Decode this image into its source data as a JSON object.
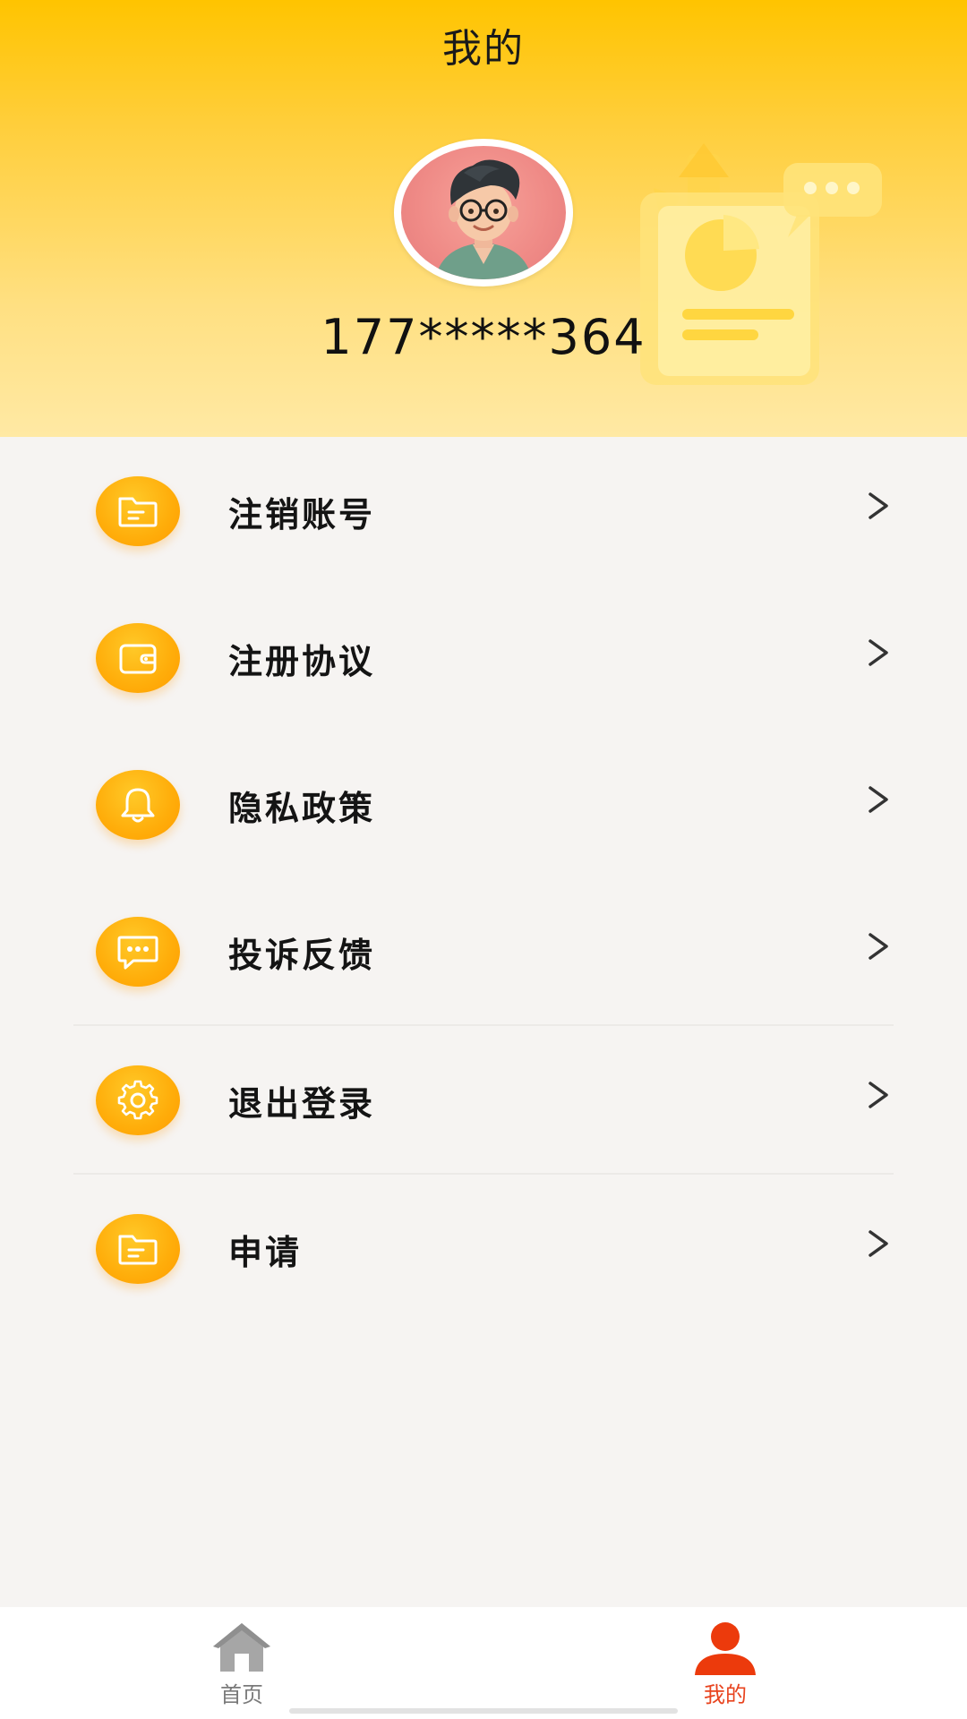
{
  "header": {
    "title": "我的",
    "phone": "177*****364",
    "gradient_top": "#ffc400",
    "gradient_bottom": "#ffe9a4"
  },
  "menu": {
    "items": [
      {
        "label": "注销账号",
        "icon": "folder-card-icon"
      },
      {
        "label": "注册协议",
        "icon": "wallet-icon"
      },
      {
        "label": "隐私政策",
        "icon": "bell-icon"
      },
      {
        "label": "投诉反馈",
        "icon": "chat-bubble-icon"
      },
      {
        "label": "退出登录",
        "icon": "gear-icon"
      },
      {
        "label": "申请",
        "icon": "folder-card-icon"
      }
    ],
    "arrow": ">",
    "icon_color": "#ffa800"
  },
  "tabbar": {
    "tabs": [
      {
        "label": "首页",
        "icon": "home-icon",
        "active": false
      },
      {
        "label": "我的",
        "icon": "user-icon",
        "active": true
      }
    ],
    "active_color": "#e8431e",
    "inactive_color": "#7a7a7a"
  }
}
